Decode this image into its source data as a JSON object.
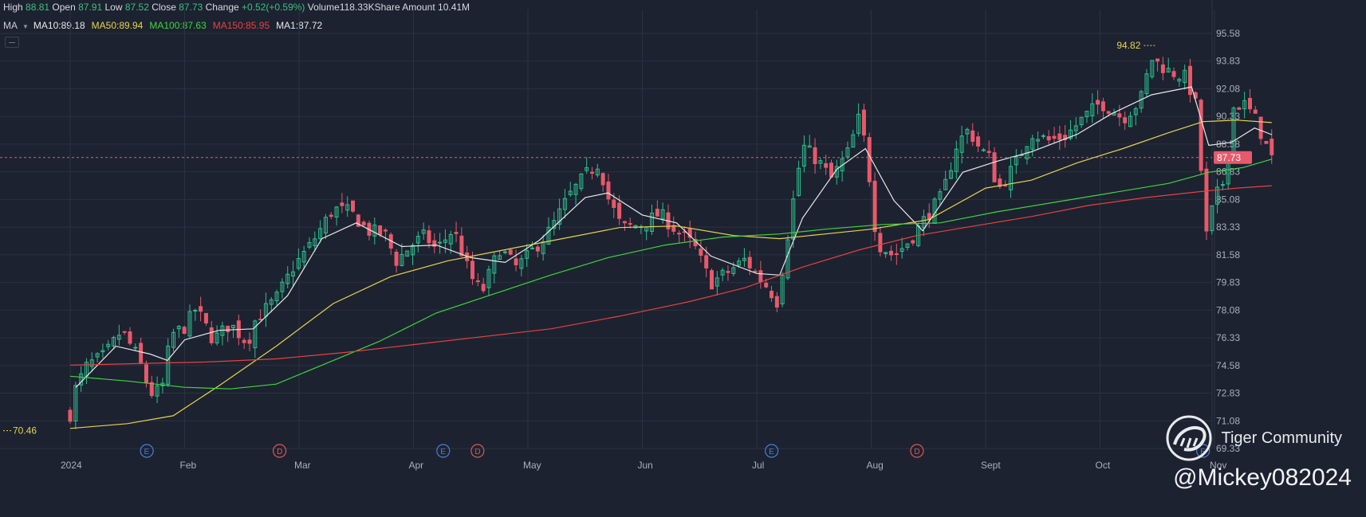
{
  "header": {
    "high_label": "High",
    "high": "88.81",
    "open_label": "Open",
    "open": "87.91",
    "low_label": "Low",
    "low": "87.52",
    "close_label": "Close",
    "close": "87.73",
    "change_label": "Change",
    "change": "+0.52(+0.59%)",
    "volume_label": "Volume",
    "volume": "118.33K",
    "amount_label": "Share Amount",
    "amount": "10.41M"
  },
  "ma_legend": {
    "title": "MA",
    "items": [
      {
        "label": "MA10:89.18",
        "color": "#e8e8e8"
      },
      {
        "label": "MA50:89.94",
        "color": "#e8d44d"
      },
      {
        "label": "MA100:87.63",
        "color": "#3fd43f"
      },
      {
        "label": "MA150:85.95",
        "color": "#e8413f"
      },
      {
        "label": "MA1:87.72",
        "color": "#e8e8e8"
      }
    ]
  },
  "watermark": {
    "name": "Tiger Community",
    "user": "@Mickey082024"
  },
  "colors": {
    "up": "#2fbf8f",
    "down": "#e8596b",
    "grid": "#2a3140",
    "axis_text": "#a9afbb"
  },
  "chart_data": {
    "type": "candlestick",
    "y_ticks": [
      "95.58",
      "93.83",
      "92.08",
      "90.33",
      "88.58",
      "86.83",
      "85.08",
      "83.33",
      "81.58",
      "79.83",
      "78.08",
      "76.33",
      "74.58",
      "72.83",
      "71.08",
      "69.33"
    ],
    "ylim": [
      69.33,
      95.58
    ],
    "x_ticks": [
      "2024",
      "Feb",
      "Mar",
      "Apr",
      "May",
      "Jun",
      "Jul",
      "Aug",
      "Sept",
      "Oct",
      "Nov"
    ],
    "x_tick_months": [
      0,
      1,
      2,
      3,
      4,
      5,
      6,
      7,
      8,
      9,
      10
    ],
    "last_price": "87.73",
    "max_marker": "94.82",
    "min_marker": "70.46",
    "events": [
      {
        "label": "E",
        "month": 0.67,
        "color": "#4a7fd8"
      },
      {
        "label": "D",
        "month": 1.83,
        "color": "#e0574f"
      },
      {
        "label": "E",
        "month": 3.26,
        "color": "#4a7fd8"
      },
      {
        "label": "D",
        "month": 3.56,
        "color": "#e0574f"
      },
      {
        "label": "E",
        "month": 6.13,
        "color": "#4a7fd8"
      },
      {
        "label": "D",
        "month": 7.4,
        "color": "#e0574f"
      },
      {
        "label": "E",
        "month": 9.9,
        "color": "#4a7fd8"
      }
    ],
    "close_anchors": [
      [
        0,
        71.5
      ],
      [
        0.05,
        73.2
      ],
      [
        0.15,
        74.6
      ],
      [
        0.3,
        75.2
      ],
      [
        0.45,
        76.8
      ],
      [
        0.6,
        75.0
      ],
      [
        0.7,
        72.8
      ],
      [
        0.8,
        73.0
      ],
      [
        0.88,
        76.5
      ],
      [
        1.0,
        77.0
      ],
      [
        1.1,
        78.2
      ],
      [
        1.25,
        76.2
      ],
      [
        1.4,
        77.2
      ],
      [
        1.55,
        76.0
      ],
      [
        1.62,
        77.5
      ],
      [
        1.8,
        78.8
      ],
      [
        1.95,
        80.8
      ],
      [
        2.1,
        82.2
      ],
      [
        2.3,
        84.5
      ],
      [
        2.45,
        84.3
      ],
      [
        2.6,
        83.1
      ],
      [
        2.75,
        82.9
      ],
      [
        2.85,
        81.2
      ],
      [
        3.0,
        82.3
      ],
      [
        3.1,
        82.8
      ],
      [
        3.2,
        81.9
      ],
      [
        3.35,
        83.2
      ],
      [
        3.5,
        80.2
      ],
      [
        3.6,
        79.2
      ],
      [
        3.75,
        82.0
      ],
      [
        3.9,
        80.8
      ],
      [
        4.0,
        81.5
      ],
      [
        4.2,
        83.2
      ],
      [
        4.35,
        85.2
      ],
      [
        4.5,
        86.6
      ],
      [
        4.62,
        87.4
      ],
      [
        4.7,
        85.2
      ],
      [
        4.82,
        83.3
      ],
      [
        5.0,
        83.5
      ],
      [
        5.15,
        84.2
      ],
      [
        5.3,
        83.1
      ],
      [
        5.45,
        82.2
      ],
      [
        5.6,
        79.8
      ],
      [
        5.75,
        80.5
      ],
      [
        5.9,
        81.3
      ],
      [
        6.0,
        80.3
      ],
      [
        6.1,
        79.5
      ],
      [
        6.18,
        78.6
      ],
      [
        6.3,
        84.2
      ],
      [
        6.4,
        88.5
      ],
      [
        6.55,
        87.4
      ],
      [
        6.65,
        86.4
      ],
      [
        6.8,
        88.1
      ],
      [
        6.9,
        90.4
      ],
      [
        6.96,
        88.0
      ],
      [
        7.05,
        82.3
      ],
      [
        7.2,
        81.5
      ],
      [
        7.35,
        82.6
      ],
      [
        7.5,
        84.2
      ],
      [
        7.62,
        85.3
      ],
      [
        7.75,
        88.6
      ],
      [
        7.85,
        89.5
      ],
      [
        7.95,
        88.3
      ],
      [
        8.05,
        87.6
      ],
      [
        8.1,
        85.6
      ],
      [
        8.25,
        87.2
      ],
      [
        8.4,
        89.3
      ],
      [
        8.55,
        88.8
      ],
      [
        8.7,
        89.1
      ],
      [
        8.85,
        90.2
      ],
      [
        9.0,
        91.2
      ],
      [
        9.1,
        90.8
      ],
      [
        9.2,
        90.2
      ],
      [
        9.35,
        91.3
      ],
      [
        9.45,
        94.0
      ],
      [
        9.6,
        93.2
      ],
      [
        9.75,
        92.8
      ],
      [
        9.85,
        90.8
      ],
      [
        9.92,
        82.5
      ],
      [
        10.0,
        85.1
      ],
      [
        10.1,
        86.5
      ],
      [
        10.15,
        90.8
      ],
      [
        10.25,
        91.2
      ],
      [
        10.35,
        90.3
      ],
      [
        10.45,
        88.5
      ],
      [
        10.5,
        87.73
      ]
    ],
    "series": [
      {
        "name": "MA10",
        "color": "#e8e8e8",
        "values": [
          [
            0.05,
            73.2
          ],
          [
            0.4,
            75.8
          ],
          [
            0.7,
            75.3
          ],
          [
            0.85,
            74.9
          ],
          [
            1.0,
            76.2
          ],
          [
            1.3,
            76.8
          ],
          [
            1.6,
            76.9
          ],
          [
            1.9,
            79.0
          ],
          [
            2.2,
            82.6
          ],
          [
            2.5,
            83.6
          ],
          [
            2.9,
            82.1
          ],
          [
            3.2,
            82.2
          ],
          [
            3.5,
            81.4
          ],
          [
            3.8,
            81.1
          ],
          [
            4.1,
            82.5
          ],
          [
            4.5,
            85.2
          ],
          [
            4.7,
            85.5
          ],
          [
            5.0,
            84.1
          ],
          [
            5.3,
            83.6
          ],
          [
            5.6,
            81.5
          ],
          [
            6.0,
            80.4
          ],
          [
            6.2,
            80.3
          ],
          [
            6.4,
            83.9
          ],
          [
            6.7,
            87.0
          ],
          [
            6.95,
            88.3
          ],
          [
            7.2,
            85.0
          ],
          [
            7.45,
            83.1
          ],
          [
            7.8,
            86.8
          ],
          [
            8.1,
            87.5
          ],
          [
            8.4,
            88.1
          ],
          [
            8.8,
            89.2
          ],
          [
            9.1,
            90.5
          ],
          [
            9.45,
            91.7
          ],
          [
            9.8,
            92.2
          ],
          [
            9.95,
            88.5
          ],
          [
            10.15,
            88.7
          ],
          [
            10.35,
            89.6
          ],
          [
            10.5,
            89.18
          ]
        ]
      },
      {
        "name": "MA50",
        "color": "#e8d44d",
        "values": [
          [
            0.0,
            70.6
          ],
          [
            0.5,
            70.9
          ],
          [
            0.9,
            71.4
          ],
          [
            1.3,
            73.3
          ],
          [
            1.8,
            75.8
          ],
          [
            2.3,
            78.5
          ],
          [
            2.8,
            80.2
          ],
          [
            3.3,
            81.2
          ],
          [
            3.8,
            81.9
          ],
          [
            4.3,
            82.6
          ],
          [
            4.8,
            83.3
          ],
          [
            5.3,
            83.4
          ],
          [
            5.8,
            82.8
          ],
          [
            6.2,
            82.6
          ],
          [
            6.6,
            82.9
          ],
          [
            7.0,
            83.2
          ],
          [
            7.5,
            83.8
          ],
          [
            8.0,
            85.8
          ],
          [
            8.4,
            86.3
          ],
          [
            8.8,
            87.4
          ],
          [
            9.2,
            88.3
          ],
          [
            9.6,
            89.3
          ],
          [
            9.9,
            90.0
          ],
          [
            10.2,
            90.1
          ],
          [
            10.5,
            89.94
          ]
        ]
      },
      {
        "name": "MA100",
        "color": "#3fd43f",
        "values": [
          [
            0.0,
            73.9
          ],
          [
            0.5,
            73.6
          ],
          [
            1.0,
            73.2
          ],
          [
            1.4,
            73.1
          ],
          [
            1.8,
            73.4
          ],
          [
            2.2,
            74.6
          ],
          [
            2.7,
            76.1
          ],
          [
            3.2,
            77.9
          ],
          [
            3.7,
            79.1
          ],
          [
            4.2,
            80.3
          ],
          [
            4.7,
            81.4
          ],
          [
            5.2,
            82.2
          ],
          [
            5.7,
            82.7
          ],
          [
            6.2,
            82.9
          ],
          [
            6.6,
            83.2
          ],
          [
            7.1,
            83.5
          ],
          [
            7.6,
            83.6
          ],
          [
            8.1,
            84.3
          ],
          [
            8.6,
            84.9
          ],
          [
            9.1,
            85.5
          ],
          [
            9.6,
            86.1
          ],
          [
            9.95,
            86.8
          ],
          [
            10.25,
            87.1
          ],
          [
            10.5,
            87.63
          ]
        ]
      },
      {
        "name": "MA150",
        "color": "#e8413f",
        "values": [
          [
            0.0,
            74.6
          ],
          [
            0.6,
            74.7
          ],
          [
            1.2,
            74.8
          ],
          [
            1.8,
            75.0
          ],
          [
            2.4,
            75.4
          ],
          [
            3.0,
            75.9
          ],
          [
            3.6,
            76.4
          ],
          [
            4.2,
            76.9
          ],
          [
            4.8,
            77.7
          ],
          [
            5.4,
            78.6
          ],
          [
            5.9,
            79.5
          ],
          [
            6.4,
            80.8
          ],
          [
            6.9,
            81.9
          ],
          [
            7.4,
            82.8
          ],
          [
            7.9,
            83.4
          ],
          [
            8.4,
            84.0
          ],
          [
            8.9,
            84.7
          ],
          [
            9.4,
            85.2
          ],
          [
            9.9,
            85.6
          ],
          [
            10.2,
            85.8
          ],
          [
            10.5,
            85.95
          ]
        ]
      }
    ]
  }
}
